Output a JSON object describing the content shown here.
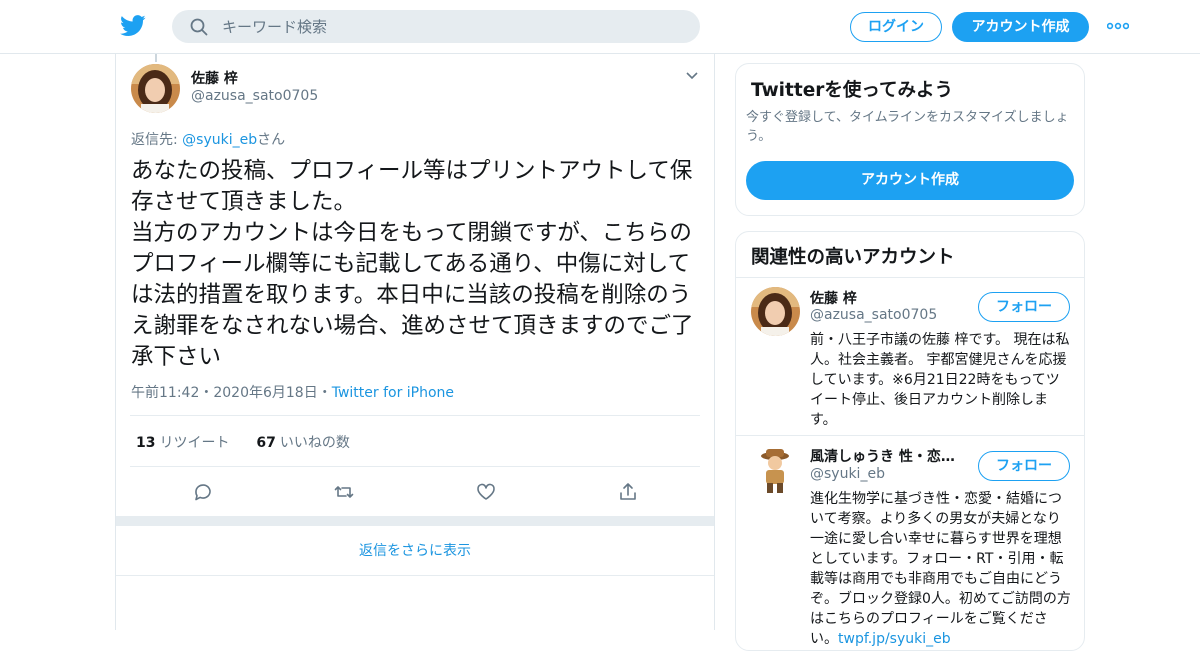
{
  "header": {
    "search_placeholder": "キーワード検索",
    "login_label": "ログイン",
    "signup_label": "アカウント作成"
  },
  "tweet": {
    "author_name": "佐藤 梓",
    "author_handle": "@azusa_sato0705",
    "replying_prefix": "返信先: ",
    "replying_handle": "@syuki_eb",
    "replying_suffix": "さん",
    "text": "あなたの投稿、プロフィール等はプリントアウトして保存させて頂きました。\n当方のアカウントは今日をもって閉鎖ですが、こちらのプロフィール欄等にも記載してある通り、中傷に対しては法的措置を取ります。本日中に当該の投稿を削除のうえ謝罪をなされない場合、進めさせて頂きますのでご了承下さい",
    "time": "午前11:42",
    "separator": "・",
    "date": "2020年6月18日",
    "source": "Twitter for iPhone",
    "retweet_count": "13",
    "retweet_label": "リツイート",
    "like_count": "67",
    "like_label": "いいねの数",
    "more_replies_label": "返信をさらに表示"
  },
  "signup_card": {
    "title": "Twitterを使ってみよう",
    "subtitle": "今すぐ登録して、タイムラインをカスタマイズしましょう。",
    "button_label": "アカウント作成"
  },
  "related_card": {
    "title": "関連性の高いアカウント",
    "accounts": [
      {
        "name": "佐藤 梓",
        "handle": "@azusa_sato0705",
        "follow_label": "フォロー",
        "bio": "前・八王子市議の佐藤 梓です。 現在は私人。社会主義者。 宇都宮健児さんを応援しています。※6月21日22時をもってツイート停止、後日アカウント削除します。"
      },
      {
        "name": "風清しゅうき 性・恋…",
        "handle": "@syuki_eb",
        "follow_label": "フォロー",
        "bio": "進化生物学に基づき性・恋愛・結婚について考察。より多くの男女が夫婦となり一途に愛し合い幸せに暮らす世界を理想としています。フォロー・RT・引用・転載等は商用でも非商用でもご自由にどうぞ。ブロック登録0人。初めてご訪問の方はこちらのプロフィールをご覧ください。",
        "bio_link": "twpf.jp/syuki_eb"
      }
    ]
  },
  "colors": {
    "brand": "#1da1f2",
    "link": "#1b95e0",
    "muted": "#657786",
    "border": "#e6ecf0"
  }
}
